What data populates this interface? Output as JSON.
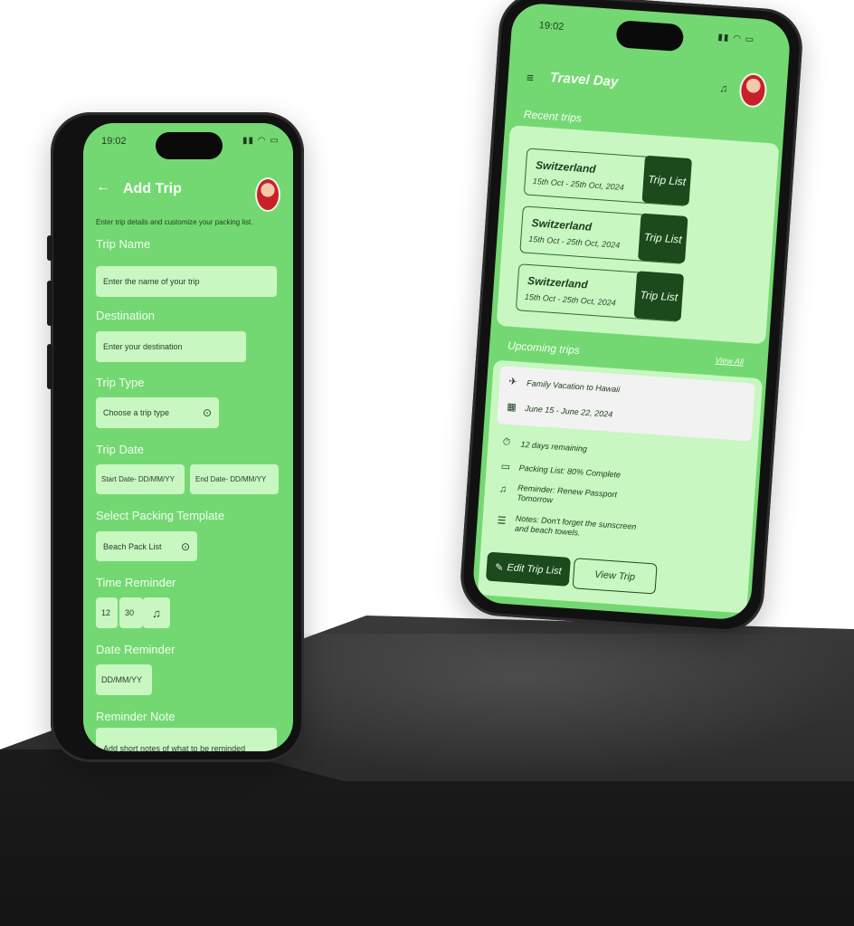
{
  "left_phone": {
    "status_time": "19:02",
    "header": {
      "title": "Add Trip"
    },
    "intro": "Enter trip details and customize your packing list.",
    "fields": {
      "trip_name_label": "Trip Name",
      "trip_name_placeholder": "Enter the name of your trip",
      "destination_label": "Destination",
      "destination_placeholder": "Enter your destination",
      "trip_type_label": "Trip Type",
      "trip_type_value": "Choose a trip type",
      "trip_date_label": "Trip Date",
      "start_date_placeholder": "Start Date- DD/MM/YY",
      "end_date_placeholder": "End Date- DD/MM/YY",
      "template_label": "Select Packing Template",
      "template_value": "Beach Pack List",
      "time_reminder_label": "Time Reminder",
      "hour": "12",
      "minute": "30",
      "date_reminder_label": "Date Reminder",
      "date_reminder_placeholder": "DD/MM/YY",
      "reminder_note_label": "Reminder Note",
      "reminder_note_placeholder": "Add short notes of what to be reminded"
    }
  },
  "right_phone": {
    "status_time": "19:02",
    "header": {
      "title": "Travel Day"
    },
    "recent_title": "Recent trips",
    "recent_trips": [
      {
        "name": "Switzerland",
        "dates": "15th Oct - 25th Oct, 2024",
        "button": "Trip List"
      },
      {
        "name": "Switzerland",
        "dates": "15th Oct - 25th Oct, 2024",
        "button": "Trip List"
      },
      {
        "name": "Switzerland",
        "dates": "15th Oct - 25th Oct, 2024",
        "button": "Trip List"
      }
    ],
    "upcoming_title": "Upcoming trips",
    "view_all": "View All",
    "upcoming": {
      "trip_name": "Family Vacation to Hawaii",
      "dates": "June 15 - June 22, 2024",
      "remaining": "12 days remaining",
      "packing": "Packing List: 80% Complete",
      "reminder_line1": "Reminder: Renew Passport",
      "reminder_line2": "Tomorrow",
      "notes_line1": "Notes: Don't forget the sunscreen",
      "notes_line2": "and beach towels.",
      "edit_button": "Edit Trip List",
      "view_button": "View Trip"
    }
  },
  "colors": {
    "screen_green": "#74d872",
    "light_green": "#c8f7c2",
    "dark_green": "#1c4a1c"
  }
}
